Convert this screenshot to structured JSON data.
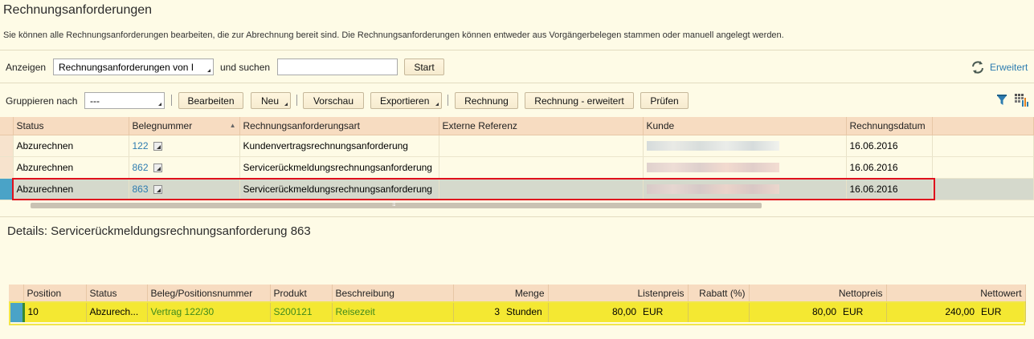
{
  "page": {
    "title": "Rechnungsanforderungen",
    "description": "Sie können alle Rechnungsanforderungen bearbeiten, die zur Abrechnung bereit sind. Die Rechnungsanforderungen können entweder aus Vorgängerbelegen stammen oder manuell angelegt werden."
  },
  "search": {
    "show_label": "Anzeigen",
    "show_value": "Rechnungsanforderungen von I",
    "and_search_label": "und suchen",
    "search_value": "",
    "start_label": "Start",
    "advanced_label": "Erweitert"
  },
  "toolbar": {
    "group_label": "Gruppieren nach",
    "group_value": "---",
    "edit": "Bearbeiten",
    "new": "Neu",
    "preview": "Vorschau",
    "export": "Exportieren",
    "invoice": "Rechnung",
    "invoice_ext": "Rechnung - erweitert",
    "check": "Prüfen"
  },
  "list": {
    "columns": [
      "Status",
      "Belegnummer",
      "Rechnungsanforderungsart",
      "Externe Referenz",
      "Kunde",
      "Rechnungsdatum"
    ],
    "rows": [
      {
        "status": "Abzurechnen",
        "number": "122",
        "type": "Kundenvertragsrechnungsanforderung",
        "ext_ref": "",
        "date": "16.06.2016"
      },
      {
        "status": "Abzurechnen",
        "number": "862",
        "type": "Servicerückmeldungsrechnungsanforderung",
        "ext_ref": "",
        "date": "16.06.2016"
      },
      {
        "status": "Abzurechnen",
        "number": "863",
        "type": "Servicerückmeldungsrechnungsanforderung",
        "ext_ref": "",
        "date": "16.06.2016"
      }
    ],
    "selected_row": 2
  },
  "details": {
    "title": "Details: Servicerückmeldungsrechnungsanforderung 863",
    "columns": [
      "Position",
      "Status",
      "Beleg/Positionsnummer",
      "Produkt",
      "Beschreibung",
      "Menge",
      "Listenpreis",
      "Rabatt (%)",
      "Nettopreis",
      "Nettowert"
    ],
    "row": {
      "position": "10",
      "status": "Abzurech...",
      "ref": "Vertrag  122/30",
      "product": "S200121",
      "description": "Reisezeit",
      "qty": "3",
      "qty_unit": "Stunden",
      "list_price": "80,00",
      "list_cur": "EUR",
      "discount": "",
      "net_price": "80,00",
      "net_price_cur": "EUR",
      "net_value": "240,00",
      "net_value_cur": "EUR"
    }
  },
  "colors": {
    "background": "#fefbe6",
    "header": "#f7dcc1",
    "selection_marker": "#4aa3c7",
    "highlight_row": "#f4e832",
    "red_outline": "#e0101c",
    "link": "#2d7cb0"
  }
}
